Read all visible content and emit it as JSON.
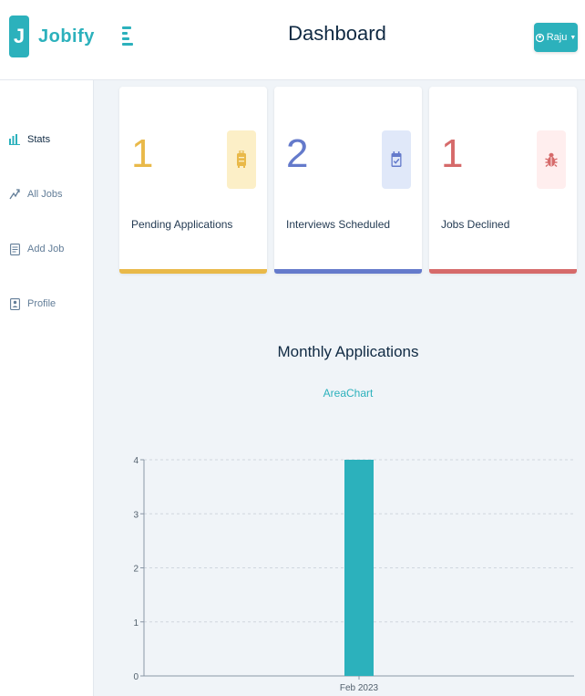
{
  "app": {
    "logo_letter": "J",
    "logo_text": "Jobify",
    "page_title": "Dashboard",
    "user_name": "Raju",
    "user_caret": "▼",
    "brand_color": "#2cb1bc"
  },
  "sidebar": {
    "items": [
      {
        "label": "Stats",
        "icon": "stats-icon",
        "active": true
      },
      {
        "label": "All Jobs",
        "icon": "all-jobs-icon",
        "active": false
      },
      {
        "label": "Add Job",
        "icon": "add-job-icon",
        "active": false
      },
      {
        "label": "Profile",
        "icon": "profile-icon",
        "active": false
      }
    ]
  },
  "stats": [
    {
      "count": "1",
      "label": "Pending Applications",
      "color": "#e9b949",
      "bg": "#fcefc7",
      "icon": "suitcase-icon"
    },
    {
      "count": "2",
      "label": "Interviews Scheduled",
      "color": "#647acb",
      "bg": "#e0e8f9",
      "icon": "calendar-check-icon"
    },
    {
      "count": "1",
      "label": "Jobs Declined",
      "color": "#d66a6a",
      "bg": "#ffeeee",
      "icon": "bug-icon"
    }
  ],
  "chart": {
    "title": "Monthly Applications",
    "toggle_label": "AreaChart"
  },
  "chart_data": {
    "type": "bar",
    "categories": [
      "Feb 2023"
    ],
    "values": [
      4
    ],
    "title": "Monthly Applications",
    "xlabel": "",
    "ylabel": "",
    "ylim": [
      0,
      4
    ],
    "yticks": [
      "0",
      "1",
      "2",
      "3",
      "4"
    ],
    "grid": true,
    "color": "#2cb1bc"
  }
}
